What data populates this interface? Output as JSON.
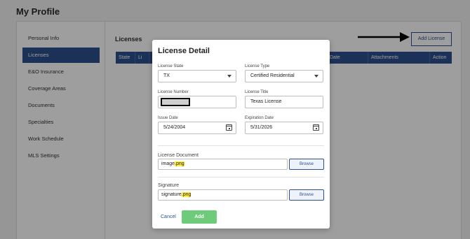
{
  "page": {
    "title": "My Profile"
  },
  "sidebar": {
    "items": [
      {
        "label": "Personal Info"
      },
      {
        "label": "Licenses"
      },
      {
        "label": "E&O Insurance"
      },
      {
        "label": "Coverage Areas"
      },
      {
        "label": "Documents"
      },
      {
        "label": "Specialties"
      },
      {
        "label": "Work Schedule"
      },
      {
        "label": "MLS Settings"
      }
    ],
    "active_label": "Licenses"
  },
  "main": {
    "section_title": "Licenses",
    "add_button_label": "Add License",
    "table": {
      "headers": [
        "State",
        "Li",
        "Date",
        "Attachments",
        "Action"
      ]
    }
  },
  "modal": {
    "title": "License Detail",
    "license_state": {
      "label": "License State",
      "value": "TX"
    },
    "license_type": {
      "label": "License Type",
      "value": "Certified Residential"
    },
    "license_number": {
      "label": "License Number",
      "value": ""
    },
    "license_title": {
      "label": "License Title",
      "value": "Texas License"
    },
    "issue_date": {
      "label": "Issue Date",
      "value": "5/24/2004"
    },
    "expiration_date": {
      "label": "Expiration Date",
      "value": "5/31/2026"
    },
    "license_document": {
      "label": "License Document",
      "value_prefix": "image",
      "value_ext": ".png",
      "browse_label": "Browse"
    },
    "signature": {
      "label": "Signature",
      "value_prefix": "signature",
      "value_ext": ".png",
      "browse_label": "Browse"
    },
    "cancel_label": "Cancel",
    "add_label": "Add"
  },
  "colors": {
    "accent": "#2e4f8f",
    "add_button": "#6ecb7a",
    "highlight": "#ffec3d"
  }
}
